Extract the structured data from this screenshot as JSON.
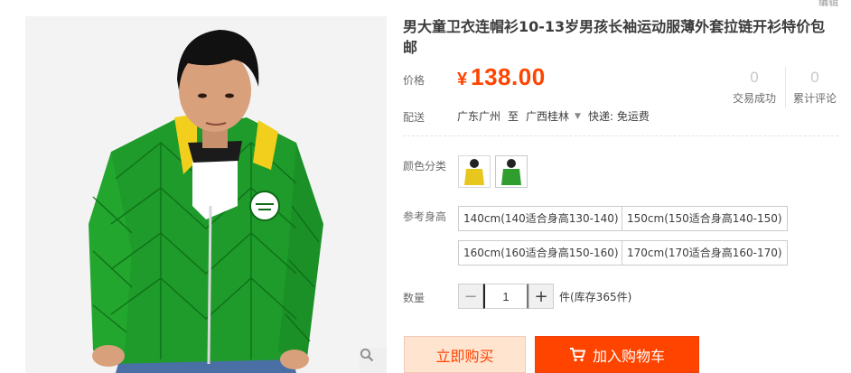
{
  "product": {
    "title": "男大童卫衣连帽衫10-13岁男孩长袖运动服薄外套拉链开衫特价包邮",
    "corner_text": "编辑"
  },
  "price": {
    "label": "价格",
    "currency": "¥",
    "value": "138.00",
    "color": "#ff4400"
  },
  "stats": [
    {
      "count": "0",
      "label": "交易成功"
    },
    {
      "count": "0",
      "label": "累计评论"
    }
  ],
  "shipping": {
    "label": "配送",
    "from": "广东广州",
    "to_word": "至",
    "destination": "广西桂林",
    "express": "快递: 免运费"
  },
  "color": {
    "label": "颜色分类",
    "options": [
      {
        "name": "yellow-hoodie",
        "color": "#e7c71e"
      },
      {
        "name": "green-hoodie",
        "color": "#2f9e2f"
      }
    ]
  },
  "size": {
    "label": "参考身高",
    "options": [
      "140cm(140适合身高130-140)",
      "150cm(150适合身高140-150)",
      "160cm(160适合身高150-160)",
      "170cm(170适合身高160-170)"
    ]
  },
  "quantity": {
    "label": "数量",
    "minus": "−",
    "value": "1",
    "plus": "+",
    "stock": "件(库存365件)"
  },
  "actions": {
    "buy_now": "立即购买",
    "add_to_cart": "加入购物车",
    "accent": "#ff4400"
  },
  "icons": {
    "zoom": "magnifier-icon",
    "cart": "cart-icon"
  }
}
